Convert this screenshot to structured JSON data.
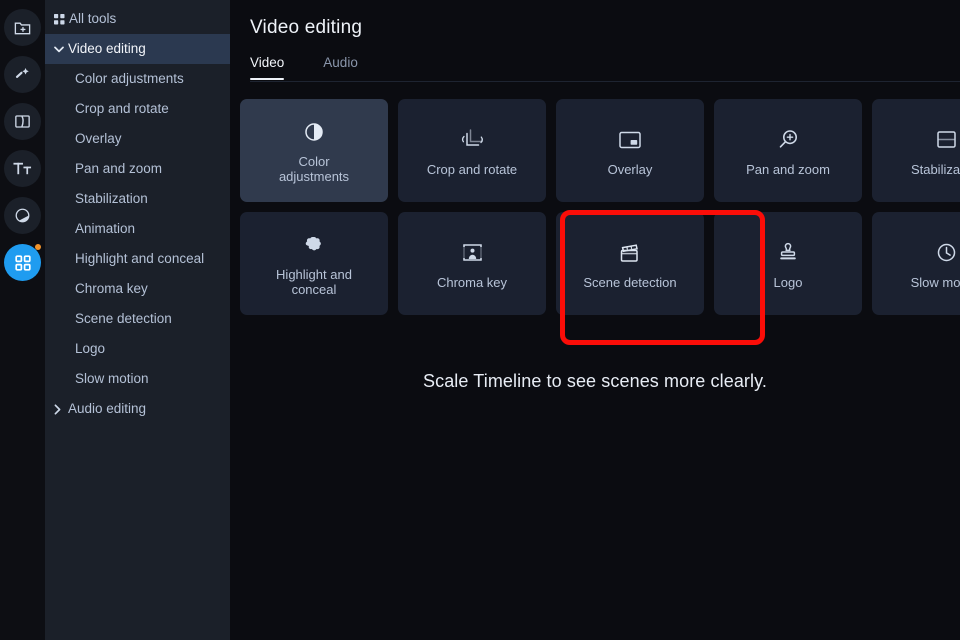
{
  "app": {
    "bg": "#0b0c11",
    "sidebar_bg": "#1b2029",
    "accent_blue": "#1f9cf0",
    "badge_orange": "#f0922b",
    "annotation_color": "#fb0d08",
    "card_bg": "#1b2130",
    "card_hover_bg": "#303a4d",
    "active_row_bg": "#2b3950"
  },
  "rail": {
    "items": [
      {
        "icon": "add-media-folder-icon",
        "active": false
      },
      {
        "icon": "magic-wand-icon",
        "active": false
      },
      {
        "icon": "transitions-icon",
        "active": false
      },
      {
        "icon": "titles-text-icon",
        "active": false
      },
      {
        "icon": "filters-icon",
        "active": false
      },
      {
        "icon": "all-tools-grid-icon",
        "active": true,
        "badge": true
      }
    ]
  },
  "sidebar": {
    "items": [
      {
        "label": "All tools",
        "type": "root",
        "icon": "grid-icon",
        "active": false
      },
      {
        "label": "Video editing",
        "type": "group",
        "icon": "chevron-down-icon",
        "active": true
      },
      {
        "label": "Color adjustments",
        "type": "child",
        "active": false
      },
      {
        "label": "Crop and rotate",
        "type": "child",
        "active": false
      },
      {
        "label": "Overlay",
        "type": "child",
        "active": false
      },
      {
        "label": "Pan and zoom",
        "type": "child",
        "active": false
      },
      {
        "label": "Stabilization",
        "type": "child",
        "active": false
      },
      {
        "label": "Animation",
        "type": "child",
        "active": false
      },
      {
        "label": "Highlight and conceal",
        "type": "child",
        "active": false
      },
      {
        "label": "Chroma key",
        "type": "child",
        "active": false
      },
      {
        "label": "Scene detection",
        "type": "child",
        "active": false
      },
      {
        "label": "Logo",
        "type": "child",
        "active": false
      },
      {
        "label": "Slow motion",
        "type": "child",
        "active": false
      },
      {
        "label": "Audio editing",
        "type": "group",
        "icon": "chevron-right-icon",
        "active": false
      }
    ]
  },
  "main": {
    "title": "Video editing",
    "tabs": [
      {
        "label": "Video",
        "active": true
      },
      {
        "label": "Audio",
        "active": false
      }
    ],
    "cards": [
      {
        "label": "Color\nadjustments",
        "icon": "contrast-circle-icon",
        "state": "hover",
        "clipped": false
      },
      {
        "label": "Crop and rotate",
        "icon": "crop-rotate-icon",
        "state": "normal",
        "clipped": false
      },
      {
        "label": "Overlay",
        "icon": "overlay-pip-icon",
        "state": "normal",
        "clipped": false
      },
      {
        "label": "Pan and zoom",
        "icon": "magnifier-plus-icon",
        "state": "normal",
        "clipped": false
      },
      {
        "label": "Stabilization",
        "icon": "stabilization-icon",
        "state": "normal",
        "clipped": true
      },
      {
        "label": "Highlight and\nconceal",
        "icon": "highlight-blob-icon",
        "state": "normal",
        "clipped": false
      },
      {
        "label": "Chroma key",
        "icon": "chroma-person-icon",
        "state": "normal",
        "clipped": false
      },
      {
        "label": "Scene detection",
        "icon": "clapperboard-icon",
        "state": "annotated",
        "clipped": false
      },
      {
        "label": "Logo",
        "icon": "stamp-icon",
        "state": "normal",
        "clipped": false
      },
      {
        "label": "Slow motion",
        "icon": "slow-motion-icon",
        "state": "normal",
        "clipped": true
      }
    ],
    "hint": "Scale Timeline to see scenes more clearly."
  }
}
